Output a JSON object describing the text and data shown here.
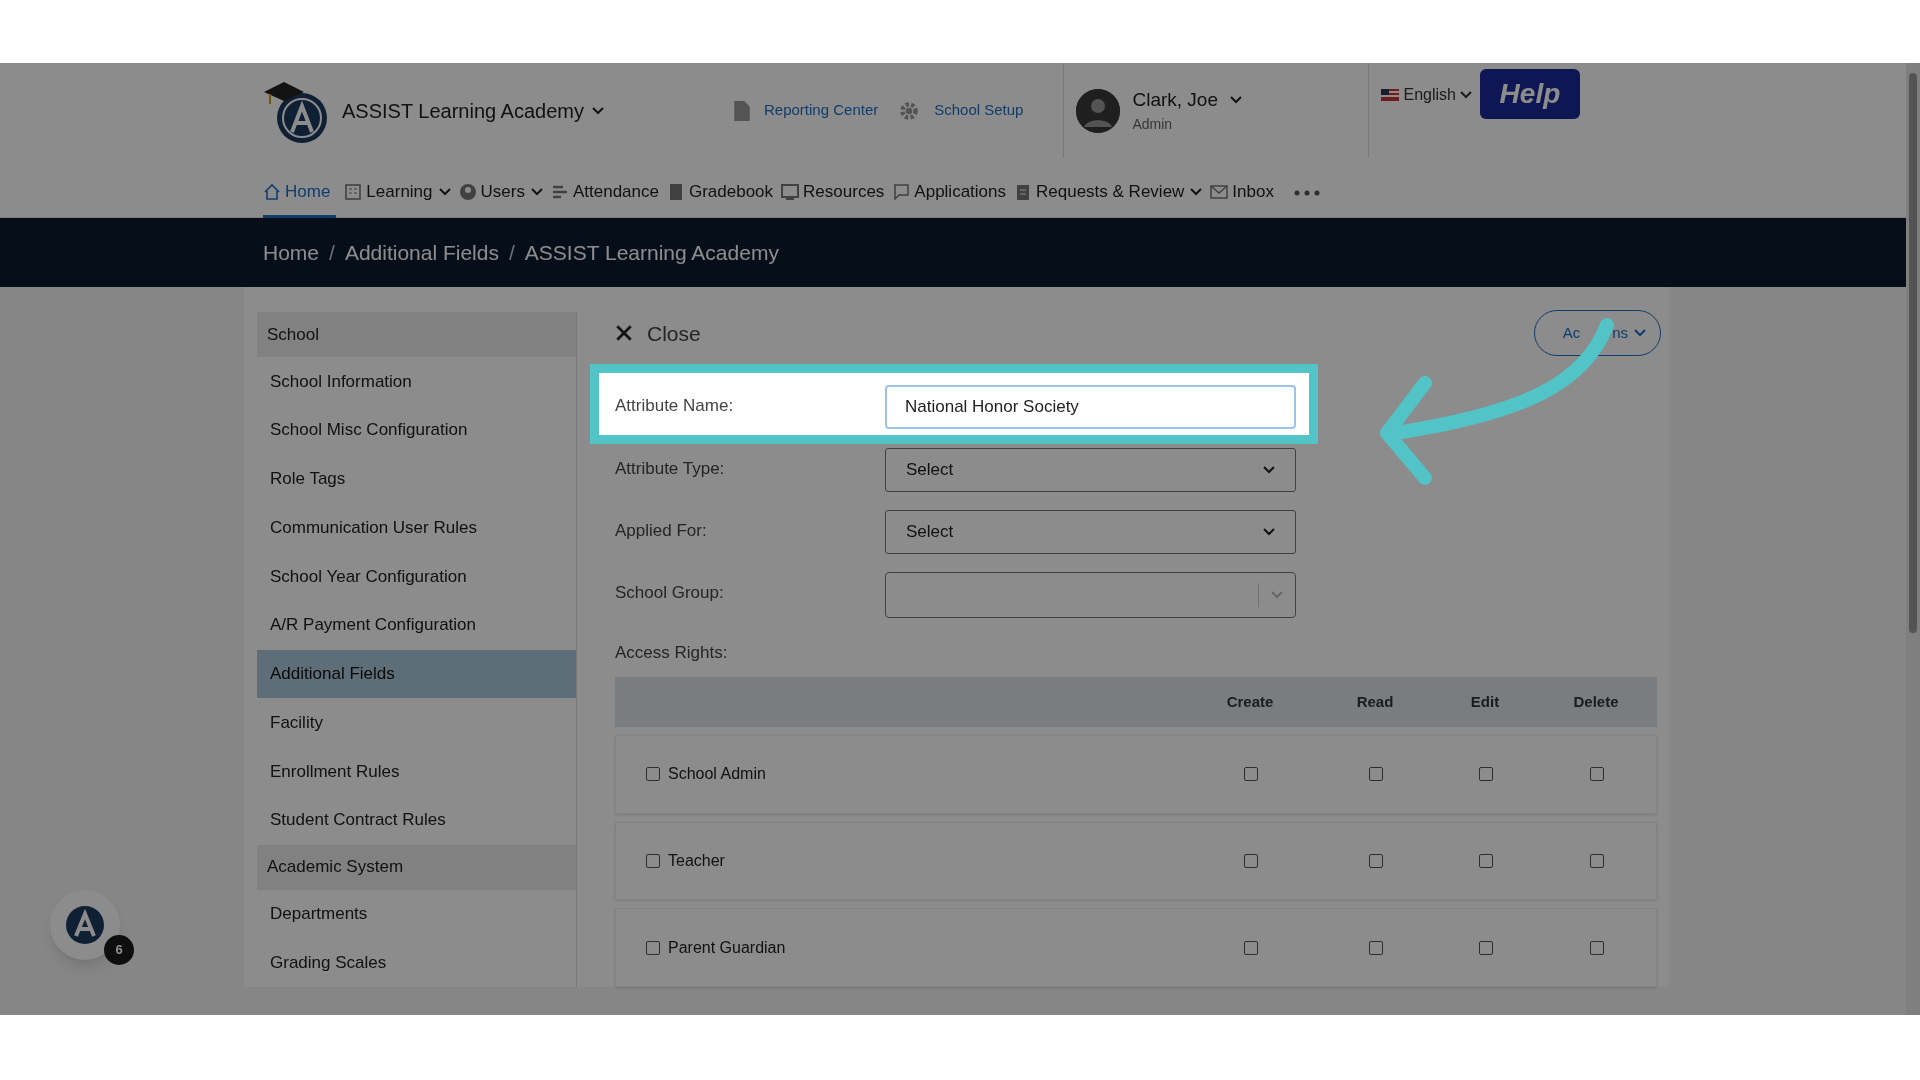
{
  "header": {
    "school_name": "ASSIST Learning Academy",
    "links": [
      "Reporting Center",
      "School Setup"
    ],
    "user": {
      "name": "Clark, Joe",
      "role": "Admin"
    },
    "language": "English",
    "help": "Help"
  },
  "nav": [
    {
      "label": "Home",
      "selected": true,
      "caret": false
    },
    {
      "label": "Learning",
      "selected": false,
      "caret": true
    },
    {
      "label": "Users",
      "selected": false,
      "caret": true
    },
    {
      "label": "Attendance",
      "selected": false,
      "caret": false
    },
    {
      "label": "Gradebook",
      "selected": false,
      "caret": false
    },
    {
      "label": "Resources",
      "selected": false,
      "caret": false
    },
    {
      "label": "Applications",
      "selected": false,
      "caret": false
    },
    {
      "label": "Requests & Review",
      "selected": false,
      "caret": true
    },
    {
      "label": "Inbox",
      "selected": false,
      "caret": false
    }
  ],
  "breadcrumb": [
    {
      "kind": "link",
      "label": "Home"
    },
    {
      "kind": "separator",
      "label": "/"
    },
    {
      "kind": "link",
      "label": "Additional Fields"
    },
    {
      "kind": "separator",
      "label": "/"
    },
    {
      "kind": "link",
      "label": "ASSIST Learning Academy"
    }
  ],
  "sidebar": [
    {
      "kind": "header",
      "label": "School"
    },
    {
      "kind": "item",
      "label": "School Information",
      "selected": false
    },
    {
      "kind": "item",
      "label": "School Misc Configuration",
      "selected": false
    },
    {
      "kind": "item",
      "label": "Role Tags",
      "selected": false
    },
    {
      "kind": "item",
      "label": "Communication User Rules",
      "selected": false
    },
    {
      "kind": "item",
      "label": "School Year Configuration",
      "selected": false
    },
    {
      "kind": "item",
      "label": "A/R Payment Configuration",
      "selected": false
    },
    {
      "kind": "item",
      "label": "Additional Fields",
      "selected": true
    },
    {
      "kind": "item",
      "label": "Facility",
      "selected": false
    },
    {
      "kind": "item",
      "label": "Enrollment Rules",
      "selected": false
    },
    {
      "kind": "item",
      "label": "Student Contract Rules",
      "selected": false
    },
    {
      "kind": "header",
      "label": "Academic System"
    },
    {
      "kind": "item",
      "label": "Departments",
      "selected": false
    },
    {
      "kind": "item",
      "label": "Grading Scales",
      "selected": false
    }
  ],
  "form": {
    "close": "Close",
    "actions": [
      "Ac",
      "ns"
    ],
    "fields": [
      {
        "kind": "text",
        "label": "Attribute Name:",
        "value": "National Honor Society",
        "highlighted": true
      },
      {
        "kind": "select",
        "label": "Attribute Type:",
        "value": "Select",
        "highlighted": false
      },
      {
        "kind": "select",
        "label": "Applied For:",
        "value": "Select",
        "highlighted": false
      },
      {
        "kind": "multiselect",
        "label": "School Group:",
        "highlighted": false
      }
    ],
    "access_rights_label": "Access Rights:",
    "columns": [
      "Create",
      "Read",
      "Edit",
      "Delete"
    ],
    "rows": [
      {
        "role": "School Admin",
        "checked": false,
        "rights": [
          false,
          false,
          false,
          false
        ]
      },
      {
        "role": "Teacher",
        "checked": false,
        "rights": [
          false,
          false,
          false,
          false
        ]
      },
      {
        "role": "Parent Guardian",
        "checked": false,
        "rights": [
          false,
          false,
          false,
          false
        ]
      }
    ]
  },
  "floating_badge": {
    "count": "6"
  }
}
